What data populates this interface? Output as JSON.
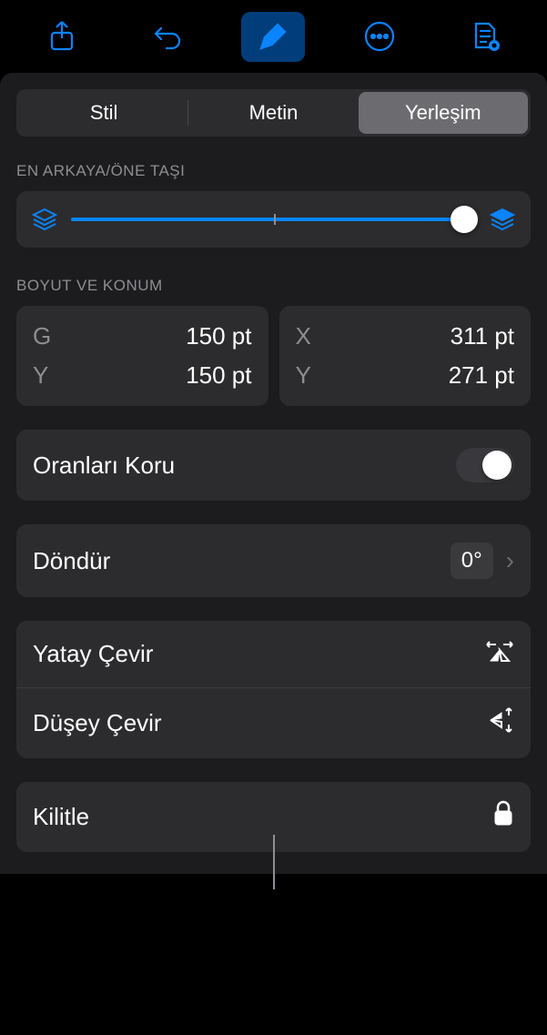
{
  "toolbar": {
    "share_icon": "share-icon",
    "undo_icon": "undo-icon",
    "format_icon": "format-brush-icon",
    "more_icon": "more-icon",
    "document_icon": "document-icon"
  },
  "segmented": {
    "style": "Stil",
    "text": "Metin",
    "layout": "Yerleşim"
  },
  "sections": {
    "move_header": "EN ARKAYA/ÖNE TAŞI",
    "size_header": "BOYUT VE KONUM"
  },
  "size": {
    "w_label": "G",
    "w_value": "150 pt",
    "h_label": "Y",
    "h_value": "150 pt",
    "x_label": "X",
    "x_value": "311 pt",
    "y_label": "Y",
    "y_value": "271 pt"
  },
  "rows": {
    "constrain": "Oranları Koru",
    "rotate": "Döndür",
    "rotate_value": "0°",
    "flip_h": "Yatay Çevir",
    "flip_v": "Düşey Çevir",
    "lock": "Kilitle"
  },
  "slider": {
    "position_percent": 100
  }
}
